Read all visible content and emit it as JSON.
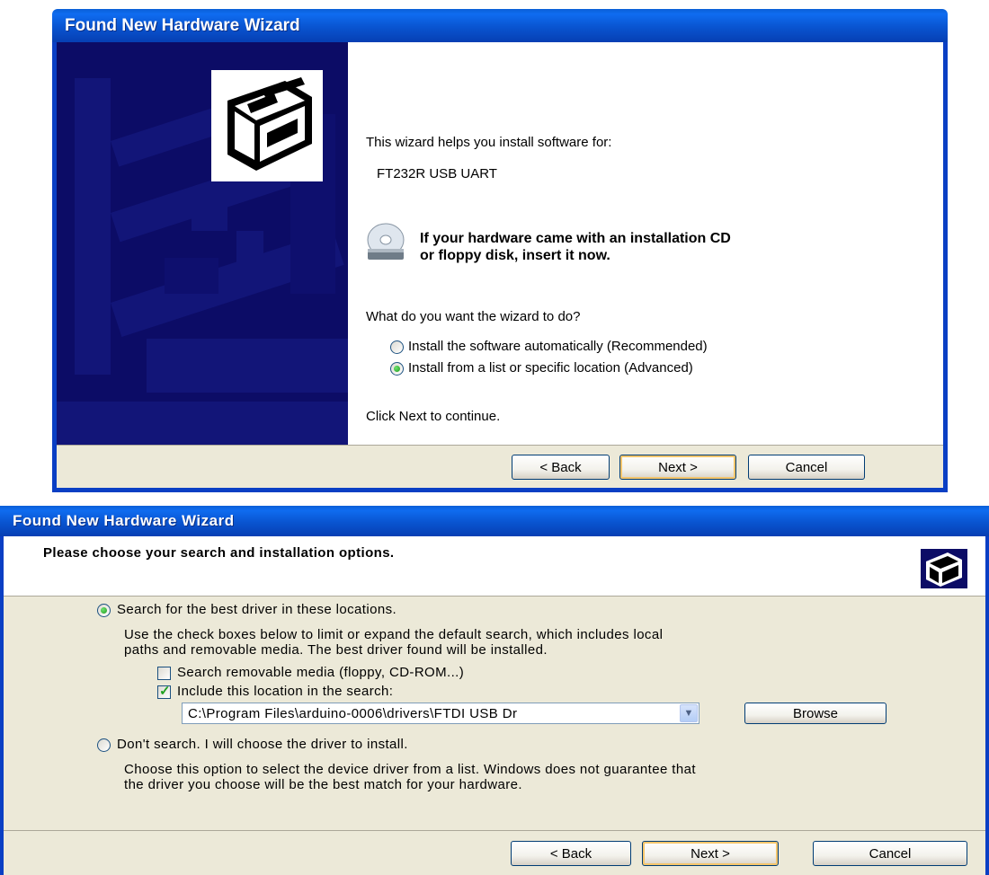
{
  "window1": {
    "title": "Found New Hardware Wizard",
    "intro": "This wizard helps you install software for:",
    "device": "FT232R USB UART",
    "cd_line1": "If your hardware came with an installation CD",
    "cd_line2": "or floppy disk, insert it now.",
    "question": "What do you want the wizard to do?",
    "options": [
      {
        "label": "Install the software automatically (Recommended)",
        "selected": false
      },
      {
        "label": "Install from a list or specific location (Advanced)",
        "selected": true
      }
    ],
    "footer_text": "Click Next to continue.",
    "buttons": {
      "back": "< Back",
      "next": "Next >",
      "cancel": "Cancel"
    }
  },
  "window2": {
    "title": "Found New Hardware Wizard",
    "heading": "Please choose your search and installation options.",
    "search_option": "Search for the best driver in these locations.",
    "search_desc1": "Use the check boxes below to limit or expand the default search, which includes local",
    "search_desc2": "paths and removable media. The best driver found will be installed.",
    "check_removable": "Search removable media (floppy, CD-ROM...)",
    "check_location": "Include this location in the search:",
    "path": "C:\\Program Files\\arduino-0006\\drivers\\FTDI USB Dr",
    "browse": "Browse",
    "dont_search": "Don't search. I will choose the driver to install.",
    "dont_desc1": "Choose this option to select the device driver from a list.  Windows does not guarantee that",
    "dont_desc2": "the driver you choose will be the best match for your hardware.",
    "buttons": {
      "back": "< Back",
      "next": "Next >",
      "cancel": "Cancel"
    }
  },
  "colors": {
    "title_blue": "#0954d0",
    "sidebar_navy": "#0c0c66",
    "dialog_face": "#ece9d8",
    "radio_green": "#1f9a1f"
  },
  "icons": [
    "hardware-wizard-icon",
    "cd-drive-icon",
    "radio-icon",
    "checkbox-icon",
    "dropdown-arrow-icon"
  ]
}
